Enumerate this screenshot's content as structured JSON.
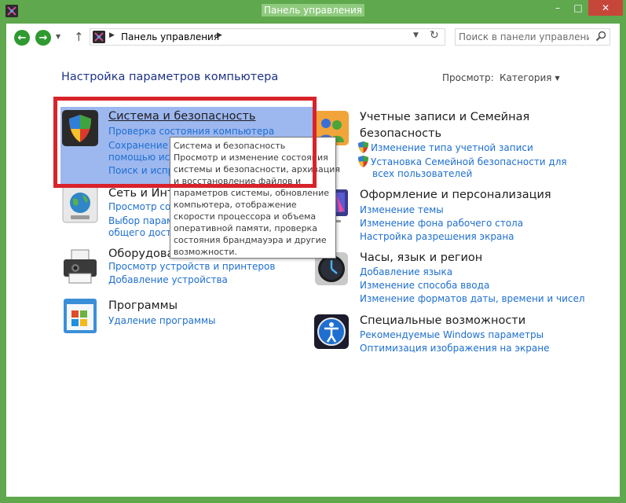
{
  "window": {
    "title": "Панель управления",
    "minimize_glyph": "–",
    "maximize_glyph": "□",
    "close_glyph": "✕",
    "accent": "#5fa84d"
  },
  "toolbar": {
    "back_glyph": "←",
    "forward_glyph": "→",
    "recent_glyph": "▼",
    "up_glyph": "↑",
    "address": {
      "separator": "▶",
      "crumb": "Панель управления",
      "history_glyph": "▼",
      "refresh_glyph": "↻"
    },
    "search": {
      "placeholder": "Поиск в панели управления",
      "value": ""
    }
  },
  "content": {
    "title": "Настройка параметров компьютера",
    "view_by_label": "Просмотр:",
    "view_by_value": "Категория"
  },
  "categories": [
    {
      "title": "Система и безопасность",
      "links": [
        "Проверка состояния компьютера",
        "Сохранение р",
        "помощью ист",
        "Поиск и испр"
      ]
    },
    {
      "title": "Сеть и Инт",
      "links": [
        "Просмотр сос",
        "Выбор парам",
        "общего досту"
      ]
    },
    {
      "title": "Оборудова",
      "links": [
        "Просмотр устройств и принтеров",
        "Добавление устройства"
      ]
    },
    {
      "title": "Программы",
      "links": [
        "Удаление программы"
      ]
    },
    {
      "title_line1": "Учетные записи и Семейная",
      "title_line2": "безопасность",
      "links": [
        "Изменение типа учетной записи",
        "Установка Семейной безопасности для",
        "всех пользователей"
      ]
    },
    {
      "title": "Оформление и персонализация",
      "links": [
        "Изменение темы",
        "Изменение фона рабочего стола",
        "Настройка разрешения экрана"
      ]
    },
    {
      "title": "Часы, язык и регион",
      "links": [
        "Добавление языка",
        "Изменение способа ввода",
        "Изменение форматов даты, времени и чисел"
      ]
    },
    {
      "title": "Специальные возможности",
      "links": [
        "Рекомендуемые Windows параметры",
        "Оптимизация изображения на экране"
      ]
    }
  ],
  "tooltip": {
    "lines": [
      "Система и безопасность",
      "Просмотр и изменение состояния",
      "системы и безопасности, архивация",
      "и восстановление файлов и",
      "параметров системы, обновление",
      "компьютера, отображение",
      "скорости процессора и объема",
      "оперативной памяти, проверка",
      "состояния брандмауэра и другие",
      "возможности."
    ]
  },
  "colors": {
    "link": "#1e6fd0",
    "heading": "#1e3287",
    "hover_highlight": "#9db7ef",
    "annotation_frame": "#d8232a"
  }
}
